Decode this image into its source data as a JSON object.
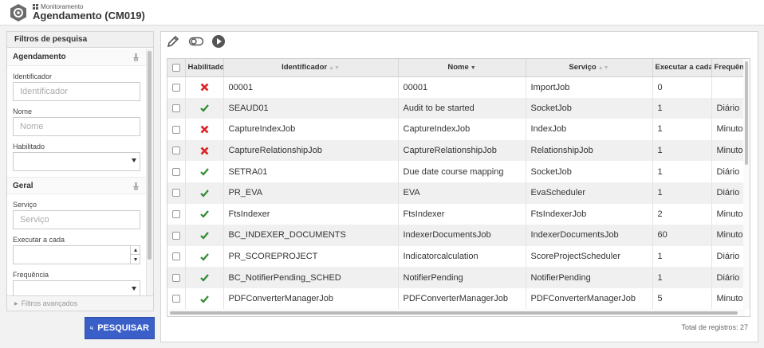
{
  "header": {
    "breadcrumb": "Monitoramento",
    "title": "Agendamento (CM019)"
  },
  "filters": {
    "title": "Filtros de pesquisa",
    "sections": {
      "agendamento": "Agendamento",
      "geral": "Geral"
    },
    "fields": {
      "identificador_label": "Identificador",
      "identificador_placeholder": "Identificador",
      "nome_label": "Nome",
      "nome_placeholder": "Nome",
      "habilitado_label": "Habilitado",
      "servico_label": "Serviço",
      "servico_placeholder": "Serviço",
      "executar_label": "Executar a cada",
      "frequencia_label": "Frequência"
    },
    "advanced": "Filtros avançados",
    "search_button": "PESQUISAR"
  },
  "table": {
    "columns": {
      "habilitado": "Habilitado",
      "identificador": "Identificador",
      "nome": "Nome",
      "servico": "Serviço",
      "executar": "Executar a cada",
      "frequencia": "Frequênc"
    },
    "rows": [
      {
        "enabled": false,
        "id": "00001",
        "name": "00001",
        "service": "ImportJob",
        "every": "0",
        "freq": ""
      },
      {
        "enabled": true,
        "id": "SEAUD01",
        "name": "Audit to be started",
        "service": "SocketJob",
        "every": "1",
        "freq": "Diário"
      },
      {
        "enabled": false,
        "id": "CaptureIndexJob",
        "name": "CaptureIndexJob",
        "service": "IndexJob",
        "every": "1",
        "freq": "Minutos"
      },
      {
        "enabled": false,
        "id": "CaptureRelationshipJob",
        "name": "CaptureRelationshipJob",
        "service": "RelationshipJob",
        "every": "1",
        "freq": "Minutos"
      },
      {
        "enabled": true,
        "id": "SETRA01",
        "name": "Due date course mapping",
        "service": "SocketJob",
        "every": "1",
        "freq": "Diário"
      },
      {
        "enabled": true,
        "id": "PR_EVA",
        "name": "EVA",
        "service": "EvaScheduler",
        "every": "1",
        "freq": "Diário"
      },
      {
        "enabled": true,
        "id": "FtsIndexer",
        "name": "FtsIndexer",
        "service": "FtsIndexerJob",
        "every": "2",
        "freq": "Minutos"
      },
      {
        "enabled": true,
        "id": "BC_INDEXER_DOCUMENTS",
        "name": "IndexerDocumentsJob",
        "service": "IndexerDocumentsJob",
        "every": "60",
        "freq": "Minutos"
      },
      {
        "enabled": true,
        "id": "PR_SCOREPROJECT",
        "name": "Indicatorcalculation",
        "service": "ScoreProjectScheduler",
        "every": "1",
        "freq": "Diário"
      },
      {
        "enabled": true,
        "id": "BC_NotifierPending_SCHED",
        "name": "NotifierPending",
        "service": "NotifierPending",
        "every": "1",
        "freq": "Diário"
      },
      {
        "enabled": true,
        "id": "PDFConverterManagerJob",
        "name": "PDFConverterManagerJob",
        "service": "PDFConverterManagerJob",
        "every": "5",
        "freq": "Minutos"
      }
    ],
    "total": "Total de registros: 27"
  },
  "icons": {
    "enabled": "check-icon",
    "disabled": "x-icon"
  },
  "colors": {
    "accent": "#3a5fc8",
    "enabled": "#2e8b2e",
    "disabled": "#e02020"
  }
}
